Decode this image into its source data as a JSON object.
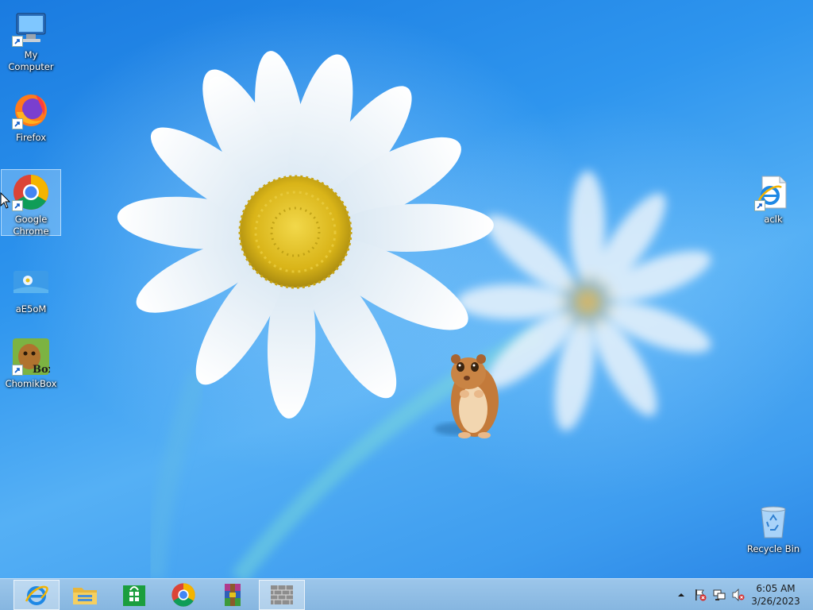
{
  "desktop": {
    "icons": [
      {
        "label": "My Computer",
        "icon": "computer-icon"
      },
      {
        "label": "Firefox",
        "icon": "firefox-icon"
      },
      {
        "label": "Google Chrome",
        "icon": "chrome-icon",
        "selected": true
      },
      {
        "label": "aE5oM",
        "icon": "image-file-icon"
      },
      {
        "label": "ChomikBox",
        "icon": "chomikbox-icon"
      },
      {
        "label": "aclk",
        "icon": "internet-explorer-file-icon"
      },
      {
        "label": "Recycle Bin",
        "icon": "recycle-bin-icon"
      }
    ]
  },
  "taskbar": {
    "pinned": [
      {
        "name": "Internet Explorer",
        "icon": "internet-explorer-icon",
        "active": true
      },
      {
        "name": "File Explorer",
        "icon": "file-explorer-icon"
      },
      {
        "name": "Store",
        "icon": "store-icon"
      },
      {
        "name": "Google Chrome",
        "icon": "chrome-icon"
      },
      {
        "name": "WinRAR",
        "icon": "winrar-icon"
      },
      {
        "name": "Firewall",
        "icon": "brick-wall-icon",
        "active": true
      }
    ],
    "tray": {
      "icons": [
        "show-hidden-icons-chevron",
        "action-center-flag-icon",
        "network-icon",
        "volume-muted-icon"
      ],
      "time": "6:05 AM",
      "date": "3/26/2023"
    }
  },
  "colors": {
    "desktop_blue": "#2f8fe6",
    "taskbar": "#92bee6",
    "daisy_center": "#e3c21c"
  }
}
